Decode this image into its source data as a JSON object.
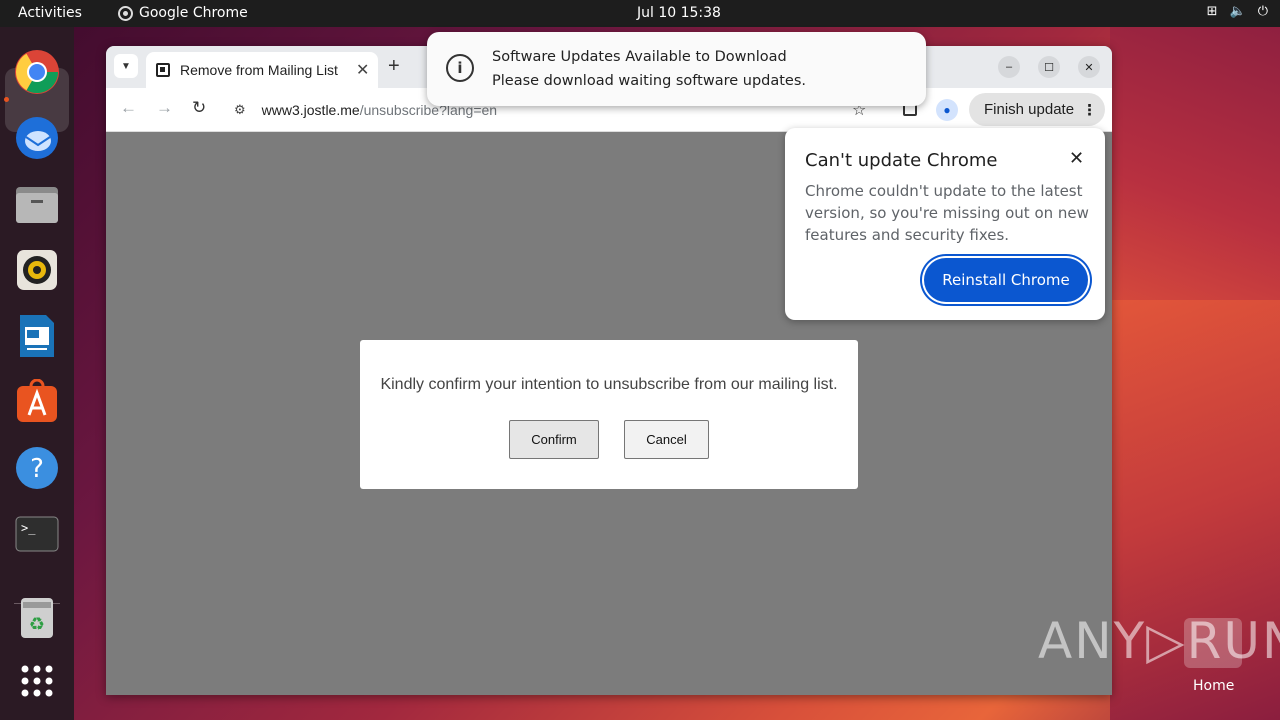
{
  "topbar": {
    "activities": "Activities",
    "app_name": "Google Chrome",
    "clock": "Jul 10  15:38",
    "tray_icons": [
      "network-icon",
      "volume-icon",
      "power-icon"
    ]
  },
  "dock": {
    "items": [
      "chrome-icon",
      "thunderbird-icon",
      "files-icon",
      "rhythmbox-icon",
      "writer-icon",
      "app-center-icon",
      "help-icon",
      "terminal-icon",
      "trash-icon",
      "apps-grid-icon"
    ]
  },
  "browser": {
    "tab_title": "Remove from Mailing List",
    "new_tab": "+",
    "url_host": "www3.jostle.me",
    "url_path": "/unsubscribe?lang=en",
    "finish_update": "Finish update"
  },
  "page": {
    "message": "Kindly confirm your intention to unsubscribe from our mailing list.",
    "confirm": "Confirm",
    "cancel": "Cancel"
  },
  "update_bubble": {
    "title": "Can't update Chrome",
    "body": "Chrome couldn't update to the latest version, so you're missing out on new features and security fixes.",
    "button": "Reinstall Chrome"
  },
  "notification": {
    "title": "Software Updates Available to Download",
    "body": "Please download waiting software updates."
  },
  "desktop": {
    "home_label": "Home",
    "watermark": "ANY RUN"
  }
}
